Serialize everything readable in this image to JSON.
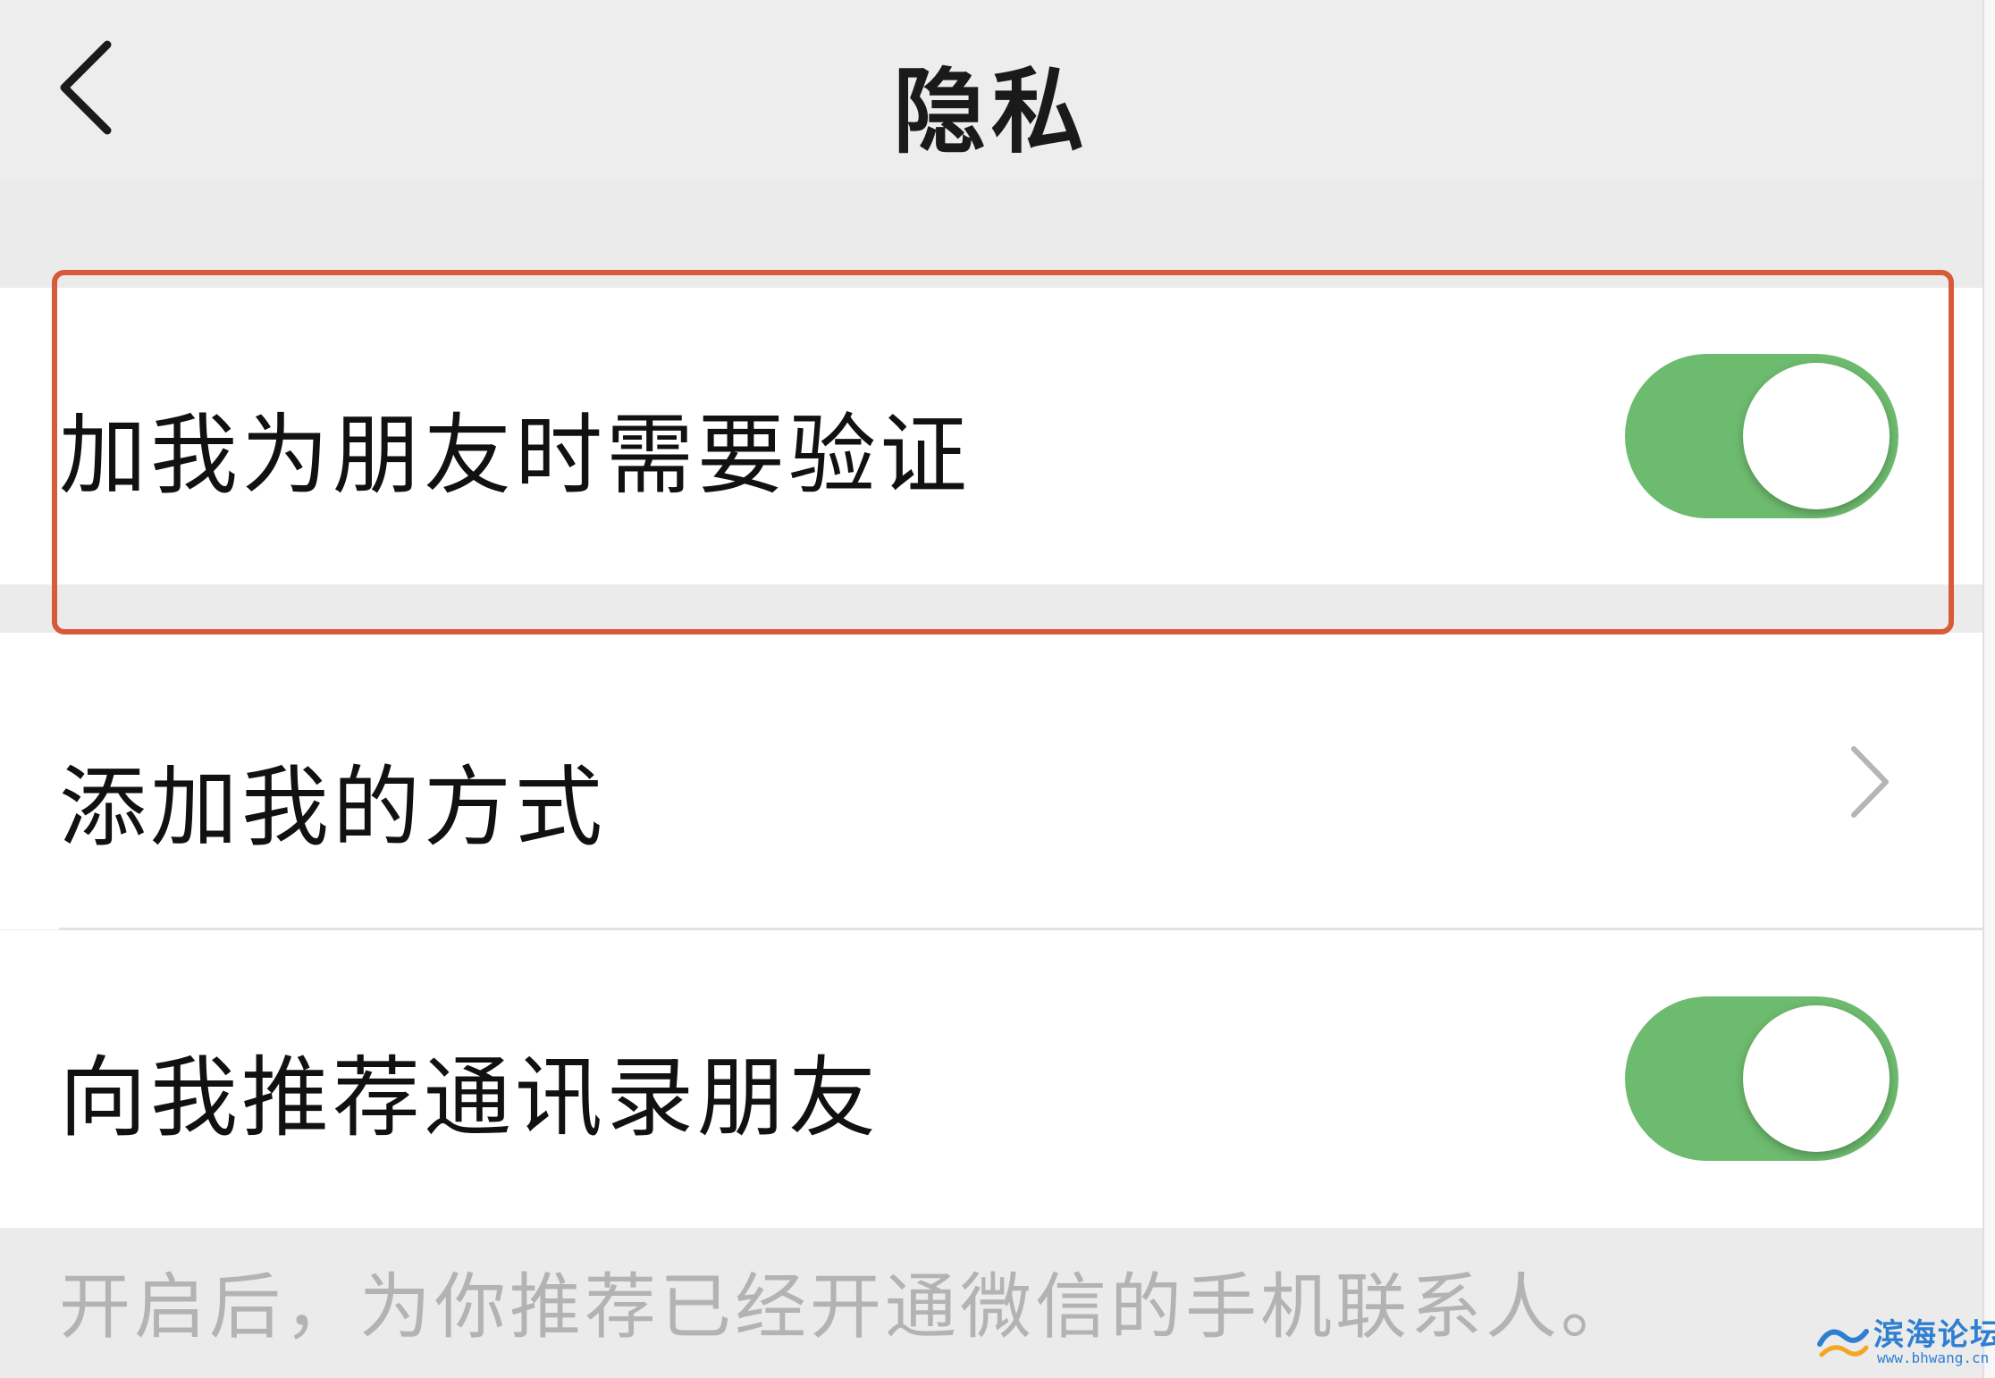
{
  "nav": {
    "title": "隐私",
    "back_icon": "chevron-left-icon"
  },
  "settings": [
    {
      "label": "加我为朋友时需要验证",
      "control": "toggle",
      "on": true,
      "highlighted": true
    },
    {
      "label": "添加我的方式",
      "control": "chevron-right-icon"
    },
    {
      "label": "向我推荐通讯录朋友",
      "control": "toggle",
      "on": true
    }
  ],
  "footnote": "开启后，为你推荐已经开通微信的手机联系人。",
  "watermark": {
    "name": "滨海论坛",
    "url": "www.bhwang.cn"
  },
  "colors": {
    "toggle_on": "#6dbb6e",
    "highlight_border": "#d9593b",
    "background": "#ebebeb"
  }
}
